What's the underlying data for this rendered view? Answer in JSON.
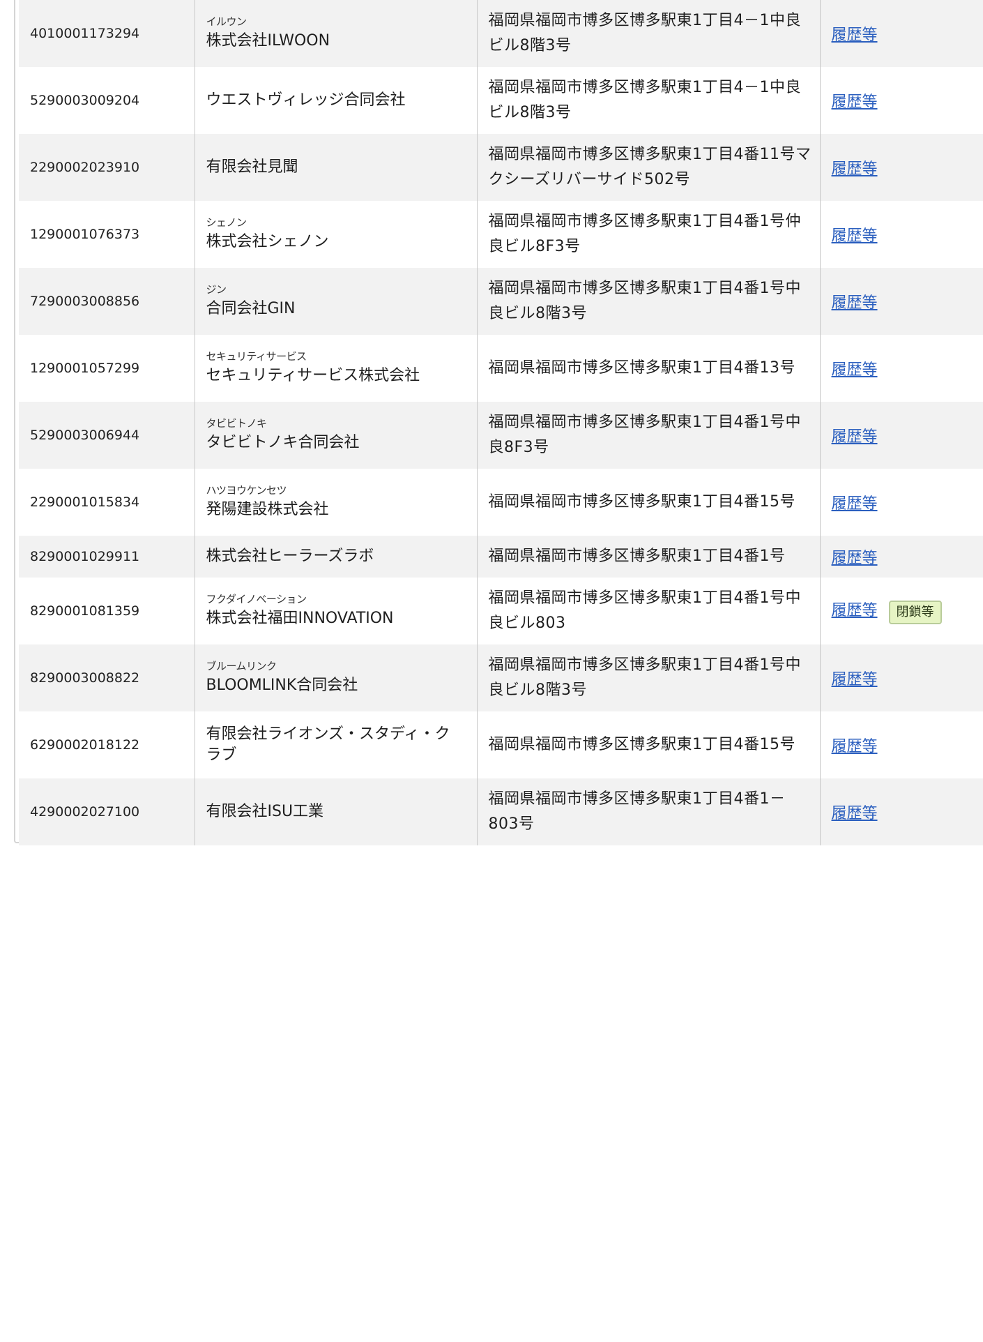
{
  "rows": [
    {
      "number": "4010001173294",
      "kana": "イルウン",
      "name": "株式会社ILWOON",
      "address": "福岡県福岡市博多区博多駅東1丁目4－1中良ビル8階3号",
      "link": "履歴等"
    },
    {
      "number": "5290003009204",
      "kana": "",
      "name": "ウエストヴィレッジ合同会社",
      "address": "福岡県福岡市博多区博多駅東1丁目4－1中良ビル8階3号",
      "link": "履歴等"
    },
    {
      "number": "2290002023910",
      "kana": "",
      "name": "有限会社見聞",
      "address": "福岡県福岡市博多区博多駅東1丁目4番11号マクシーズリバーサイド502号",
      "link": "履歴等"
    },
    {
      "number": "1290001076373",
      "kana": "シェノン",
      "name": "株式会社シェノン",
      "address": "福岡県福岡市博多区博多駅東1丁目4番1号仲良ビル8F3号",
      "link": "履歴等"
    },
    {
      "number": "7290003008856",
      "kana": "ジン",
      "name": "合同会社GIN",
      "address": "福岡県福岡市博多区博多駅東1丁目4番1号中良ビル8階3号",
      "link": "履歴等"
    },
    {
      "number": "1290001057299",
      "kana": "セキュリティサービス",
      "name": "セキュリティサービス株式会社",
      "address": "福岡県福岡市博多区博多駅東1丁目4番13号",
      "link": "履歴等"
    },
    {
      "number": "5290003006944",
      "kana": "タビビトノキ",
      "name": "タビビトノキ合同会社",
      "address": "福岡県福岡市博多区博多駅東1丁目4番1号中良8F3号",
      "link": "履歴等"
    },
    {
      "number": "2290001015834",
      "kana": "ハツヨウケンセツ",
      "name": "発陽建設株式会社",
      "address": "福岡県福岡市博多区博多駅東1丁目4番15号",
      "link": "履歴等"
    },
    {
      "number": "8290001029911",
      "kana": "",
      "name": "株式会社ヒーラーズラボ",
      "address": "福岡県福岡市博多区博多駅東1丁目4番1号",
      "link": "履歴等"
    },
    {
      "number": "8290001081359",
      "kana": "フクダイノベーション",
      "name": "株式会社福田INNOVATION",
      "address": "福岡県福岡市博多区博多駅東1丁目4番1号中良ビル803",
      "link": "履歴等",
      "badge": "閉鎖等"
    },
    {
      "number": "8290003008822",
      "kana": "ブルームリンク",
      "name": "BLOOMLINK合同会社",
      "address": "福岡県福岡市博多区博多駅東1丁目4番1号中良ビル8階3号",
      "link": "履歴等"
    },
    {
      "number": "6290002018122",
      "kana": "",
      "name": "有限会社ライオンズ・スタディ・クラブ",
      "address": "福岡県福岡市博多区博多駅東1丁目4番15号",
      "link": "履歴等"
    },
    {
      "number": "4290002027100",
      "kana": "",
      "name": "有限会社ISU工業",
      "address": "福岡県福岡市博多区博多駅東1丁目4番1－803号",
      "link": "履歴等"
    }
  ]
}
